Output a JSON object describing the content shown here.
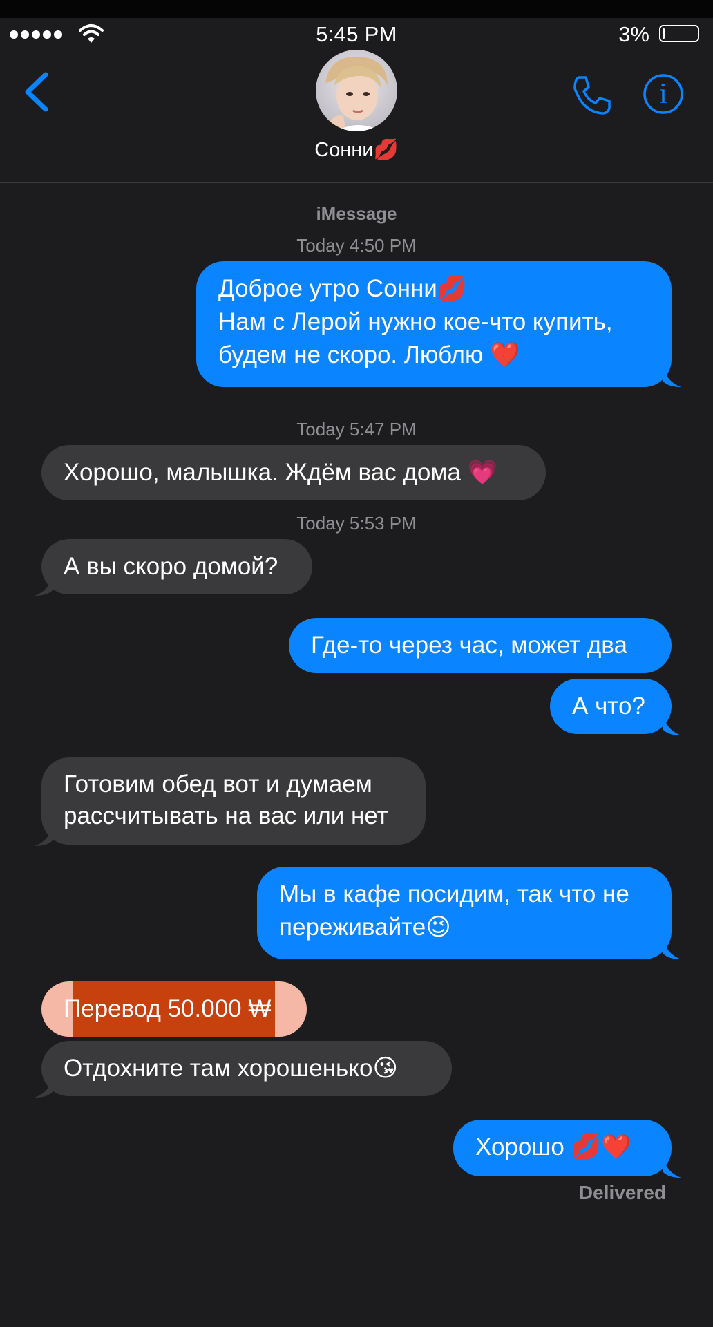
{
  "status_bar": {
    "time": "5:45 PM",
    "battery_percent": "3%"
  },
  "header": {
    "contact_name": "Сонни💋",
    "avatar_icon": "avatar-photo",
    "back_icon": "chevron-left-icon",
    "phone_icon": "phone-icon",
    "info_icon": "info-icon",
    "info_glyph": "i"
  },
  "colors": {
    "background": "#1c1c1e",
    "outgoing": "#0a84ff",
    "incoming": "#3a3a3c",
    "transfer": "#c7410f",
    "accent": "#0a84ff"
  },
  "thread": {
    "service": "iMessage",
    "timestamps": [
      "Today 4:50 PM",
      "Today 5:47 PM",
      "Today 5:53 PM"
    ],
    "messages": [
      {
        "dir": "out",
        "lines": [
          "Доброе утро Сонни💋",
          "Нам с Лерой нужно кое-что купить,",
          "будем не скоро. Люблю ❤️"
        ]
      },
      {
        "dir": "in",
        "lines": [
          "Хорошо, малышка. Ждём вас дома 💗"
        ]
      },
      {
        "dir": "in",
        "lines": [
          "А вы скоро домой?"
        ]
      },
      {
        "dir": "out",
        "lines": [
          "Где-то через час, может два"
        ]
      },
      {
        "dir": "out",
        "lines": [
          "А что?"
        ]
      },
      {
        "dir": "in",
        "lines": [
          "Готовим обед вот и думаем",
          "рассчитывать на вас или нет"
        ]
      },
      {
        "dir": "out",
        "lines": [
          "Мы в кафе посидим, так что не",
          "переживайте😉"
        ]
      },
      {
        "dir": "in",
        "lines": [
          "Перевод 50.000 ₩"
        ]
      },
      {
        "dir": "in",
        "lines": [
          "Отдохните там хорошенько😘"
        ]
      },
      {
        "dir": "out",
        "lines": [
          "Хорошо 💋❤️"
        ]
      }
    ],
    "delivered": "Delivered"
  }
}
